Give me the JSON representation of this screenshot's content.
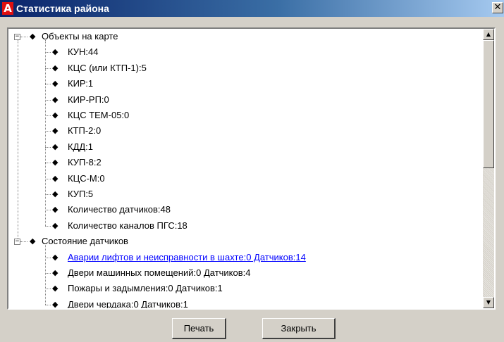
{
  "window": {
    "title": "Статистика района",
    "app_icon_glyph": "A",
    "app_icon_color": "#e01010",
    "close_glyph": "✕"
  },
  "tree": {
    "groups": [
      {
        "label": "Объекты на карте",
        "expander": "−",
        "items": [
          {
            "label": "КУН:44"
          },
          {
            "label": "КЦС (или КТП-1):5"
          },
          {
            "label": "КИР:1"
          },
          {
            "label": "КИР-РП:0"
          },
          {
            "label": "КЦС ТЕМ-05:0"
          },
          {
            "label": "КТП-2:0"
          },
          {
            "label": "КДД:1"
          },
          {
            "label": "КУП-8:2"
          },
          {
            "label": "КЦС-М:0"
          },
          {
            "label": "КУП:5"
          },
          {
            "label": "Количество датчиков:48"
          },
          {
            "label": "Количество каналов ПГС:18"
          }
        ]
      },
      {
        "label": "Состояние датчиков",
        "expander": "−",
        "items": [
          {
            "label": "Аварии лифтов и неисправности в шахте:0 Датчиков:14",
            "link": true
          },
          {
            "label": "Двери машинных помещений:0 Датчиков:4"
          },
          {
            "label": "Пожары и задымления:0 Датчиков:1"
          },
          {
            "label": "Двери чердака:0 Датчиков:1"
          }
        ]
      }
    ],
    "node_glyph": "◆"
  },
  "scrollbar": {
    "up_glyph": "▲",
    "down_glyph": "▼"
  },
  "buttons": {
    "print_label": "Печать",
    "close_label": "Закрыть"
  },
  "colors": {
    "title_gradient_start": "#0a246a",
    "link": "#0000ff",
    "dialog_face": "#d4d0c8"
  }
}
